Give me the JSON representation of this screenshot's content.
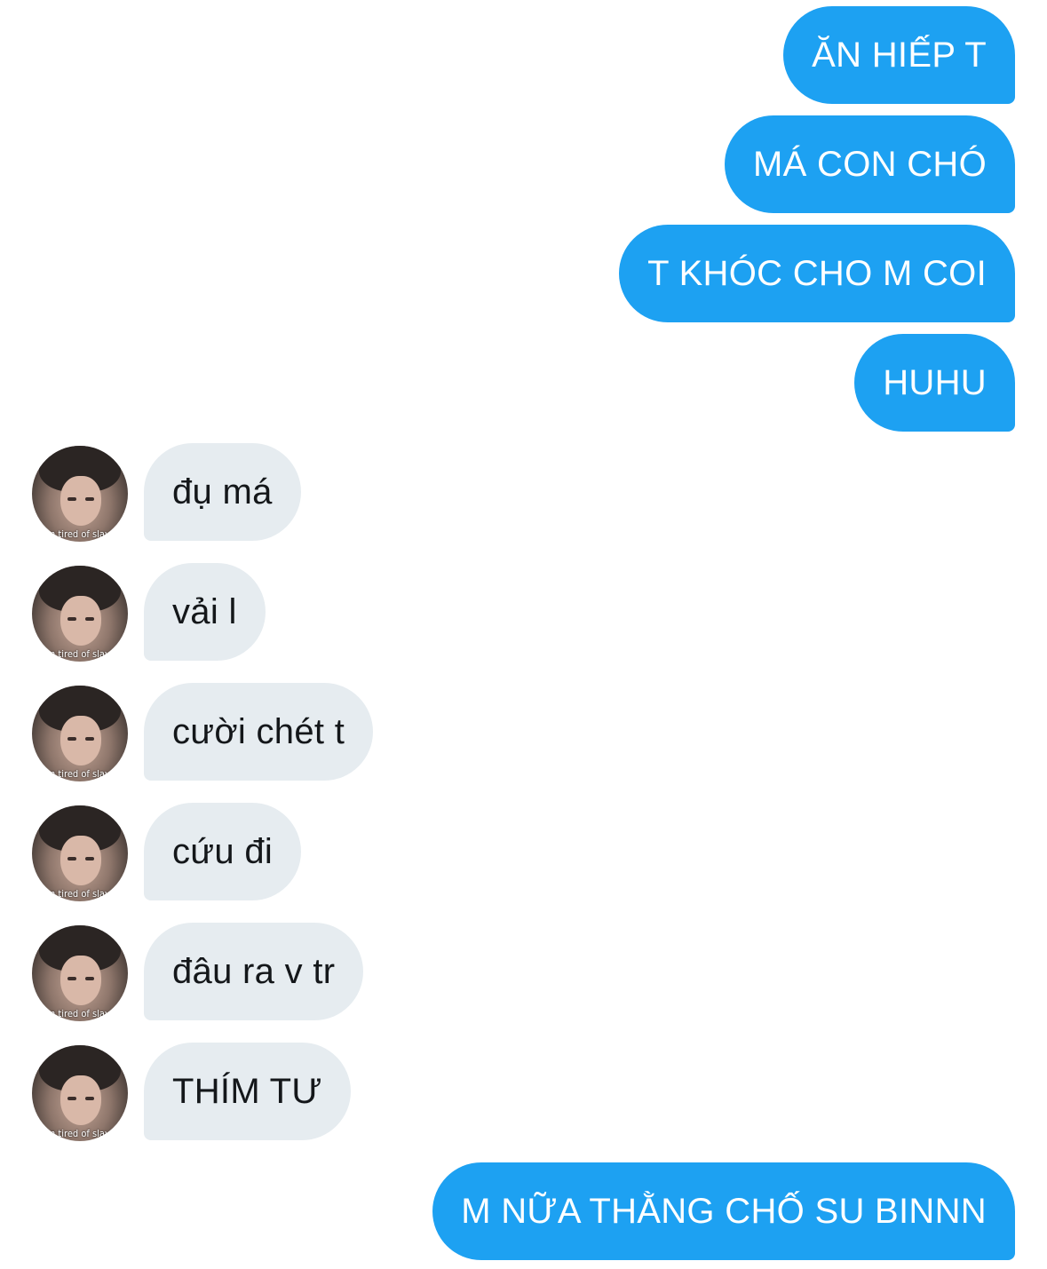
{
  "colors": {
    "sent_bubble": "#1da1f2",
    "received_bubble": "#e6ecf0",
    "sent_text": "#ffffff",
    "received_text": "#14171a"
  },
  "avatar": {
    "icon": "profile-photo",
    "caption": "i'm tired of slavin"
  },
  "messages": [
    {
      "side": "sent",
      "text": "ĂN HIẾP T"
    },
    {
      "side": "sent",
      "text": "MÁ CON CHÓ"
    },
    {
      "side": "sent",
      "text": "T KHÓC CHO M COI"
    },
    {
      "side": "sent",
      "text": "HUHU"
    },
    {
      "side": "received",
      "text": "đụ má"
    },
    {
      "side": "received",
      "text": "vải l"
    },
    {
      "side": "received",
      "text": "cười chét t"
    },
    {
      "side": "received",
      "text": "cứu đi"
    },
    {
      "side": "received",
      "text": "đâu ra v tr"
    },
    {
      "side": "received",
      "text": "THÍM TƯ"
    },
    {
      "side": "sent",
      "text": "M NỮA THẰNG CHỐ SU BINNN"
    }
  ]
}
